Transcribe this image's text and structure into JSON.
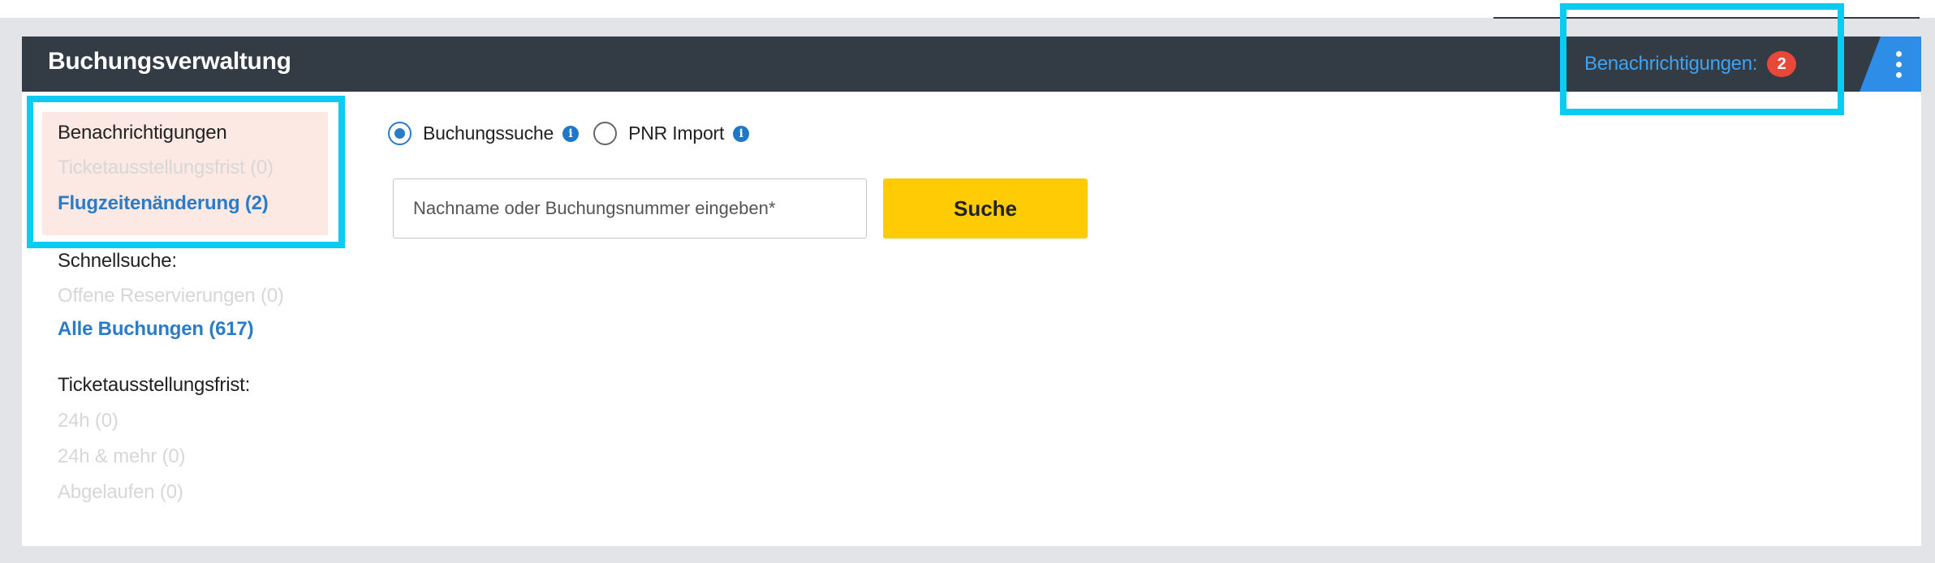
{
  "header": {
    "title": "Buchungsverwaltung",
    "notifications_label": "Benachrichtigungen:",
    "notifications_count": "2"
  },
  "sidebar": {
    "notifications": {
      "heading": "Benachrichtigungen",
      "items": [
        {
          "label": "Ticketausstellungsfrist (0)",
          "enabled": false
        },
        {
          "label": "Flugzeitenänderung (2)",
          "enabled": true
        }
      ]
    },
    "quick_search": {
      "heading": "Schnellsuche:",
      "items": [
        {
          "label": "Offene Reservierungen (0)",
          "enabled": false
        },
        {
          "label": "Alle Buchungen (617)",
          "enabled": true
        }
      ]
    },
    "ticketing_deadline": {
      "heading": "Ticketausstellungsfrist:",
      "items": [
        {
          "label": "24h (0)",
          "enabled": false
        },
        {
          "label": "24h & mehr (0)",
          "enabled": false
        },
        {
          "label": "Abgelaufen (0)",
          "enabled": false
        }
      ]
    }
  },
  "search": {
    "modes": [
      {
        "label": "Buchungssuche",
        "selected": true
      },
      {
        "label": "PNR Import",
        "selected": false
      }
    ],
    "input_value": "",
    "input_placeholder": "Nachname oder Buchungsnummer eingeben*",
    "button_label": "Suche"
  },
  "colors": {
    "header_bg": "#333b44",
    "accent_blue": "#2e8de6",
    "link_blue": "#2b7cc8",
    "badge_red": "#e8483a",
    "search_button": "#ffcb05",
    "highlight": "#0ccbf2",
    "notification_bg": "#fde9e4"
  },
  "icons": {
    "info": "info-icon",
    "menu": "kebab-menu-icon"
  }
}
